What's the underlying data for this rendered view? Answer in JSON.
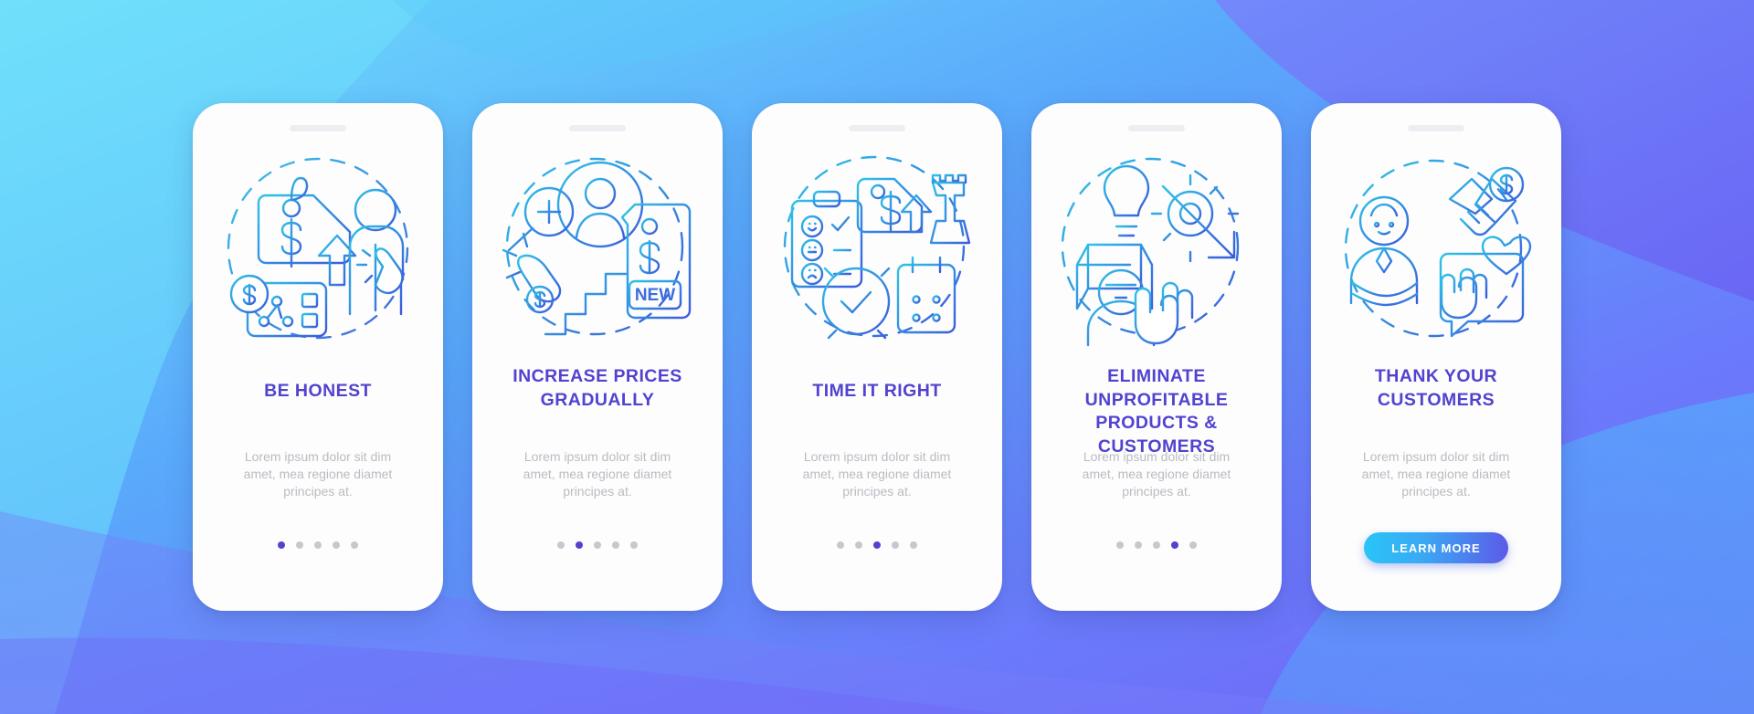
{
  "theme": {
    "bg_cyan": "#6fe0fb",
    "bg_blue": "#59a8fb",
    "bg_indigo": "#6b6bfb",
    "bg_violet": "#6f63f5",
    "title_color": "#5143cf",
    "body_color": "#b9bcc2",
    "dot_color": "#c6c8cd",
    "dot_active_color": "#5143cf",
    "stroke_cyan": "#2fc3e8",
    "stroke_blue": "#3b5bdb",
    "cta_gradient_from": "#29c5f6",
    "cta_gradient_to": "#5b5be8"
  },
  "shared": {
    "body_text": "Lorem ipsum dolor sit dim amet, mea regione diamet principes at.",
    "dot_count": 5
  },
  "screens": [
    {
      "id": "be-honest",
      "title": "BE HONEST",
      "body": "Lorem ipsum dolor sit dim amet, mea regione diamet principes at.",
      "active_dot": 1,
      "illustration": "price-tag-dollar-arrow-person-chart",
      "has_cta": false
    },
    {
      "id": "increase-prices-gradually",
      "title": "INCREASE PRICES GRADUALLY",
      "body": "Lorem ipsum dolor sit dim amet, mea regione diamet principes at.",
      "active_dot": 2,
      "illustration": "magnifier-person-hand-stairs-new-tag",
      "illustration_label": "NEW",
      "has_cta": false
    },
    {
      "id": "time-it-right",
      "title": "TIME IT RIGHT",
      "body": "Lorem ipsum dolor sit dim amet, mea regione diamet principes at.",
      "active_dot": 3,
      "illustration": "checklist-price-tag-chess-rook-alarm-clock-calendar",
      "has_cta": false
    },
    {
      "id": "eliminate-unprofitable-products-customers",
      "title": "ELIMINATE UNPROFITABLE PRODUCTS & CUSTOMERS",
      "body": "Lorem ipsum dolor sit dim amet, mea regione diamet principes at.",
      "active_dot": 4,
      "illustration": "lightbulb-box-gear-down-arrow-person-stop-hand",
      "has_cta": false
    },
    {
      "id": "thank-your-customers",
      "title": "THANK YOUR CUSTOMERS",
      "body": "Lorem ipsum dolor sit dim amet, mea regione diamet principes at.",
      "active_dot": 3,
      "illustration": "person-handshake-dollar-heart-hand-chat",
      "has_cta": true,
      "cta_label": "LEARN MORE"
    }
  ]
}
